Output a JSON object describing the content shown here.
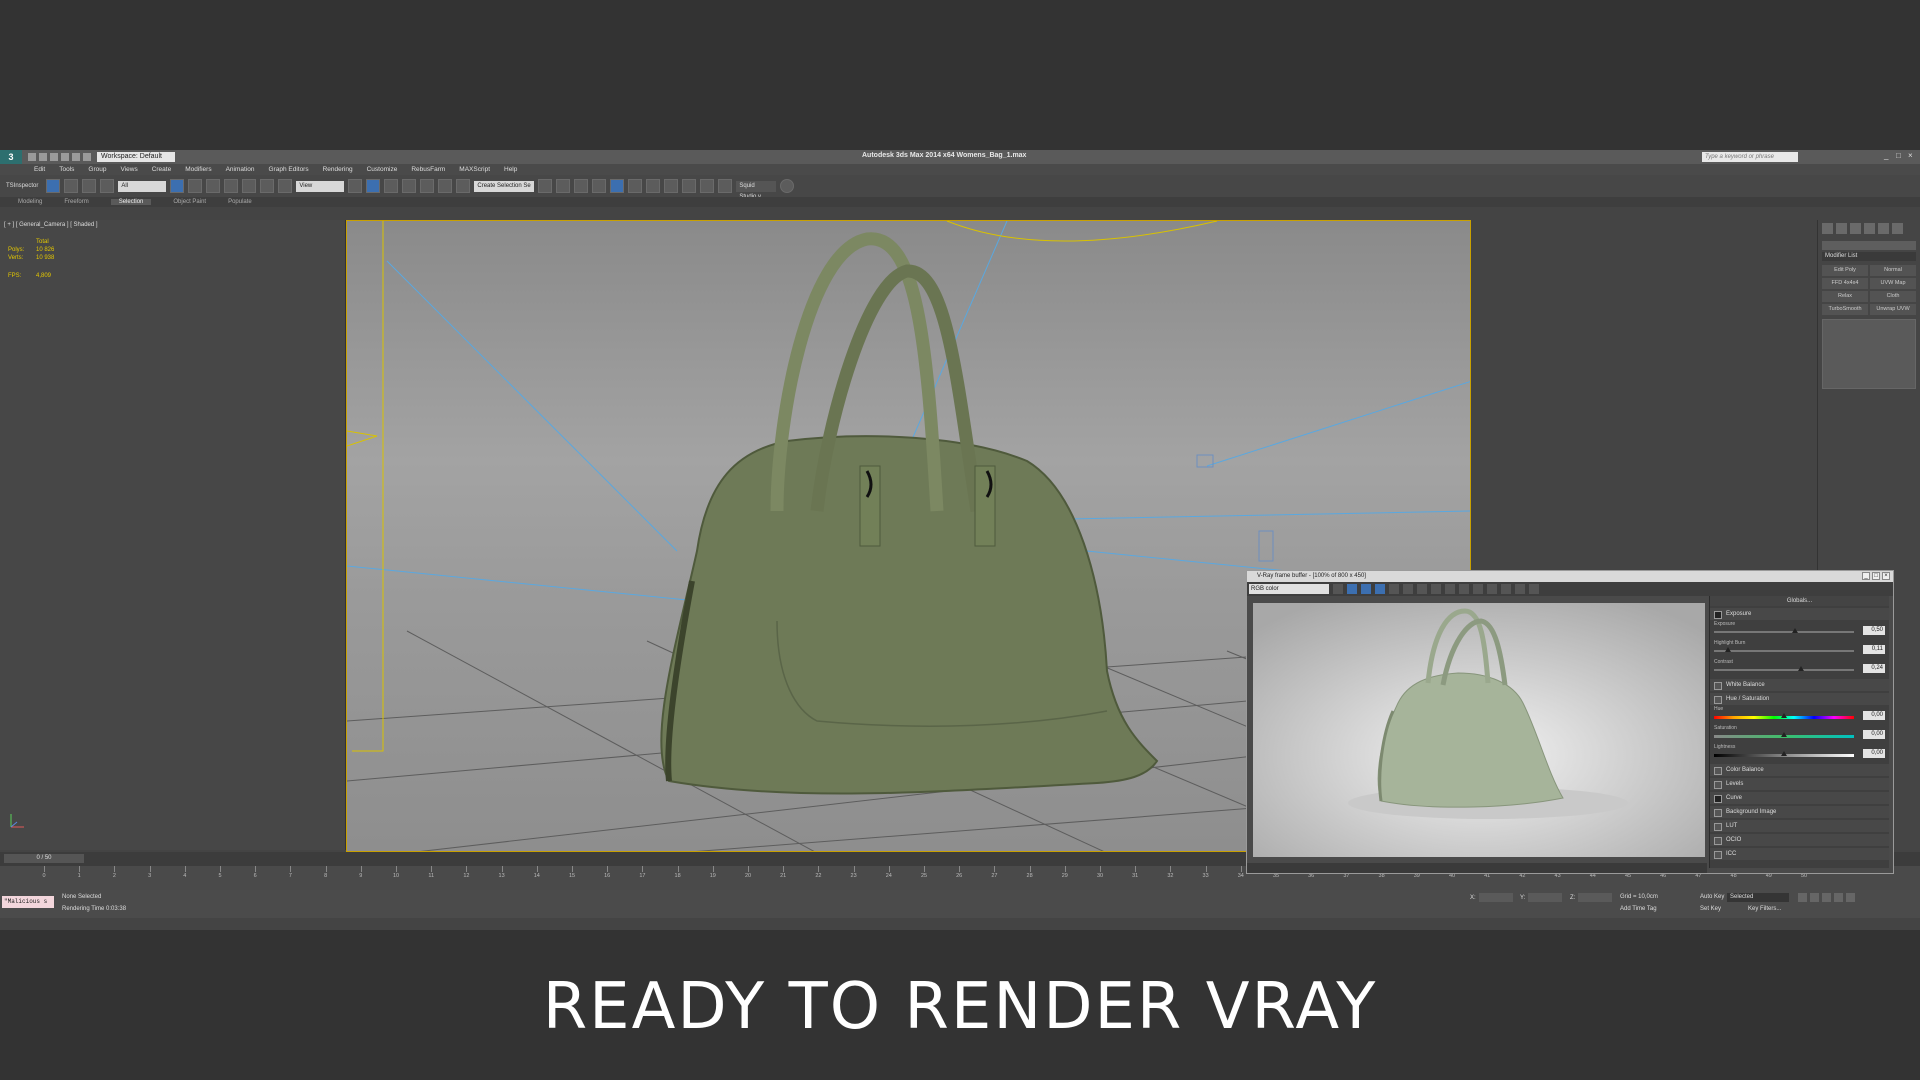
{
  "app": {
    "title": "Autodesk 3ds Max  2014 x64    Womens_Bag_1.max",
    "logo": "3",
    "workspace": "Workspace: Default",
    "search_placeholder": "Type a keyword or phrase"
  },
  "menu": [
    "Edit",
    "Tools",
    "Group",
    "Views",
    "Create",
    "Modifiers",
    "Animation",
    "Graph Editors",
    "Rendering",
    "Customize",
    "RebusFarm",
    "MAXScript",
    "Help"
  ],
  "toolbar": {
    "inspector_label": "TSInspector",
    "filter_dropdown": "All",
    "view_dropdown": "View",
    "selection_set": "Create Selection Se",
    "studio": "Squid Studio v"
  },
  "ribbon": {
    "tabs": [
      "Modeling",
      "Freeform",
      "Selection",
      "Object Paint",
      "Populate"
    ],
    "active": "Selection"
  },
  "viewport": {
    "label": "[ + ] [ General_Camera ] [ Shaded ]",
    "stats": {
      "total_label": "Total",
      "polys_label": "Polys:",
      "polys": "10 826",
      "verts_label": "Verts:",
      "verts": "10 938",
      "fps_label": "FPS:",
      "fps": "4,809"
    }
  },
  "command_panel": {
    "modifier_list": "Modifier List",
    "buttons": [
      "Edit Poly",
      "Normal",
      "FFD 4x4x4",
      "UVW Map",
      "Relax",
      "Cloth",
      "TurboSmooth",
      "Unwrap UVW"
    ]
  },
  "timeline": {
    "slider": "0 / 50",
    "ticks": [
      "0",
      "1",
      "2",
      "3",
      "4",
      "5",
      "6",
      "7",
      "8",
      "9",
      "10",
      "11",
      "12",
      "13",
      "14",
      "15",
      "16",
      "17",
      "18",
      "19",
      "20",
      "21",
      "22",
      "23",
      "24",
      "25",
      "26",
      "27",
      "28",
      "29",
      "30",
      "31",
      "32",
      "33",
      "34",
      "35",
      "36",
      "37",
      "38",
      "39",
      "40",
      "41",
      "42",
      "43",
      "44",
      "45",
      "46",
      "47",
      "48",
      "49",
      "50"
    ]
  },
  "status": {
    "maxscript": "\"Malicious s",
    "selection": "None Selected",
    "render_time": "Rendering Time  0:03:38",
    "x_label": "X:",
    "y_label": "Y:",
    "z_label": "Z:",
    "grid": "Grid = 10,0cm",
    "add_time_tag": "Add Time Tag",
    "auto_key": "Auto Key",
    "auto_key_mode": "Selected",
    "set_key": "Set Key",
    "key_filters": "Key Filters..."
  },
  "vfb": {
    "title": "V-Ray frame buffer - [100% of 800 x 450]",
    "channel": "RGB color",
    "globals": "Globals...",
    "exposure": {
      "section": "Exposure",
      "exposure_label": "Exposure",
      "exposure_value": "0,50",
      "exposure_level": 0.58,
      "highlight_label": "Highlight Burn",
      "highlight_value": "0,11",
      "highlight_level": 0.1,
      "contrast_label": "Contrast",
      "contrast_value": "0,24",
      "contrast_level": 0.62
    },
    "white_balance": "White Balance",
    "hue_saturation": {
      "section": "Hue / Saturation",
      "hue_label": "Hue",
      "hue_value": "0,00",
      "hue_level": 0.5,
      "saturation_label": "Saturation",
      "saturation_value": "0,00",
      "saturation_level": 0.5,
      "lightness_label": "Lightness",
      "lightness_value": "0,00",
      "lightness_level": 0.5
    },
    "sections": [
      {
        "label": "Color Balance",
        "checked": false
      },
      {
        "label": "Levels",
        "checked": false
      },
      {
        "label": "Curve",
        "checked": true
      },
      {
        "label": "Background Image",
        "checked": false
      },
      {
        "label": "LUT",
        "checked": false
      },
      {
        "label": "OCIO",
        "checked": false
      },
      {
        "label": "ICC",
        "checked": false
      }
    ]
  },
  "caption": "READY TO RENDER  VRAY",
  "colors": {
    "bag_green": "#6e7a57",
    "render_bag": "#a6b49a",
    "camera_line": "#5aa8e0",
    "wire_yellow": "#d9c200"
  }
}
